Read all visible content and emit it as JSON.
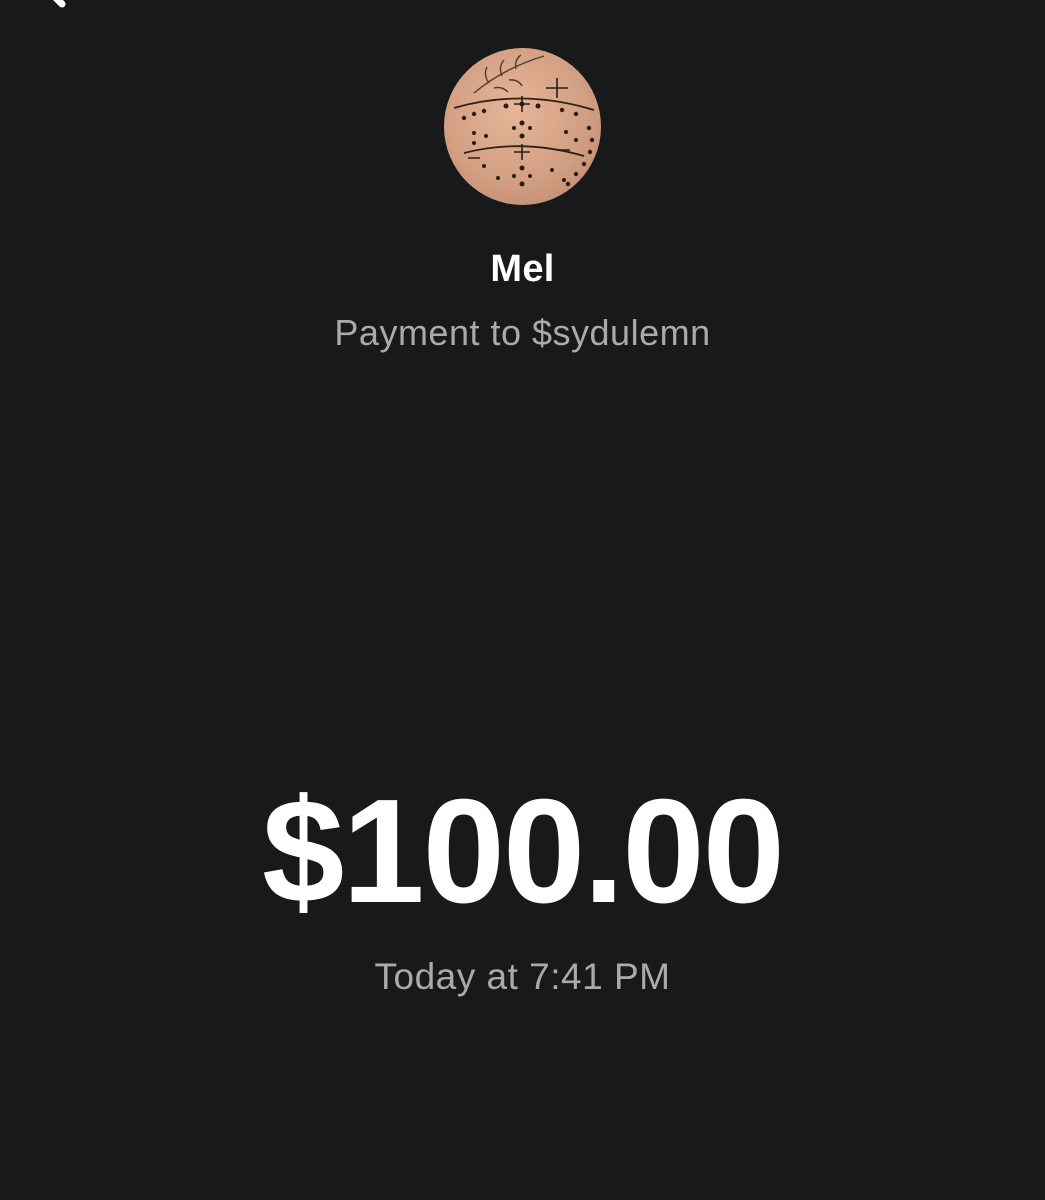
{
  "header": {
    "back_icon": "chevron-left-icon"
  },
  "recipient": {
    "avatar_icon": "profile-photo-avatar",
    "name": "Mel",
    "subtitle": "Payment to $sydulemn"
  },
  "payment": {
    "amount": "$100.00",
    "timestamp": "Today at 7:41 PM"
  },
  "colors": {
    "background": "#18191b",
    "primary_text": "#ffffff",
    "secondary_text": "#a9aaac"
  }
}
